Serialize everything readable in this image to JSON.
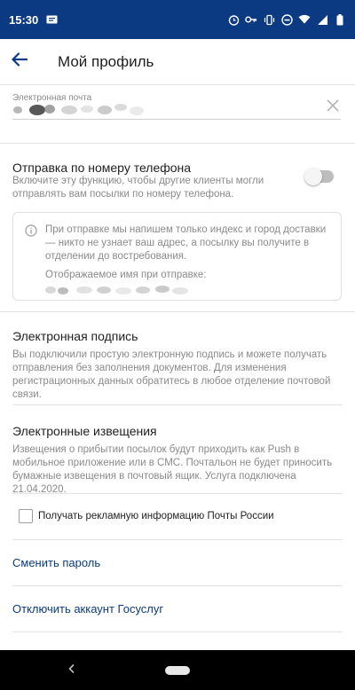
{
  "status_bar": {
    "time": "15:30"
  },
  "app_bar": {
    "title": "Мой профиль",
    "back_icon": "arrow-left-icon"
  },
  "email": {
    "label": "Электронная почта",
    "value": "",
    "clear_icon": "close-icon"
  },
  "phone_sending": {
    "title": "Отправка по номеру телефона",
    "description": "Включите эту функцию, чтобы другие клиенты могли отправлять вам посылки по номеру телефона.",
    "toggle_on": false,
    "info": {
      "icon": "info-icon",
      "text": "При отправке мы напишем только индекс и город доставки — никто не узнает ваш адрес, а посылку вы получите в отделении до востребования.",
      "shown_name_label": "Отображаемое имя при отправке:",
      "shown_name_value": ""
    }
  },
  "signature": {
    "title": "Электронная подпись",
    "description": "Вы подключили простую электронную подпись и можете получать отправления без заполнения документов. Для изменения регистрационных данных обратитесь в любое отделение почтовой связи."
  },
  "notifications": {
    "title": "Электронные извещения",
    "description": "Извещения о прибытии посылок будут приходить как Push в мобильное приложение или в СМС. Почтальон не будет приносить бумажные извещения в почтовый ящик. Услуга подключена 21.04.2020.",
    "ads_checkbox_label": "Получать рекламную информацию Почты России",
    "ads_checked": false
  },
  "links": {
    "change_password": "Сменить пароль",
    "disconnect_gosuslugi": "Отключить аккаунт Госуслуг"
  },
  "colors": {
    "status_bar": "#0b3a82",
    "accent_link": "#0b3a82",
    "muted_text": "#8a8a8a"
  }
}
